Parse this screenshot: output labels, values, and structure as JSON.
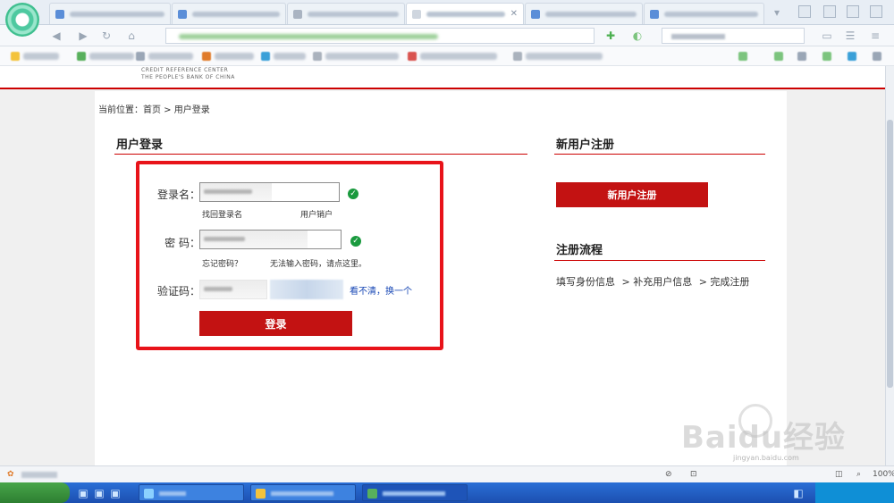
{
  "browser": {
    "zoom": "100%"
  },
  "header": {
    "org_line1": "CREDIT REFERENCE CENTER",
    "org_line2": "THE PEOPLE'S BANK OF CHINA"
  },
  "breadcrumb": {
    "text": "当前位置：首页 > 用户登录"
  },
  "login": {
    "title": "用户登录",
    "username_label": "登录名：",
    "find_username": "找回登录名",
    "cancel_account": "用户销户",
    "password_label": "密  码：",
    "forgot_password": "忘记密码？",
    "cannot_input": "无法输入密码，请点这里。",
    "captcha_label": "验证码：",
    "captcha_refresh": "看不清，换一个",
    "submit_label": "登录"
  },
  "register": {
    "title": "新用户注册",
    "button_label": "新用户注册",
    "process_title": "注册流程",
    "steps": [
      "填写身份信息",
      "> 补充用户信息",
      "> 完成注册"
    ]
  },
  "watermark": {
    "text": "Baidu经验",
    "sub": "jingyan.baidu.com"
  },
  "colors": {
    "brand_red": "#c31212",
    "highlight_red": "#e8131a",
    "ok_green": "#1a9a3e",
    "link_blue": "#1747b5"
  },
  "icons": {
    "validated": "check-circle-icon"
  }
}
